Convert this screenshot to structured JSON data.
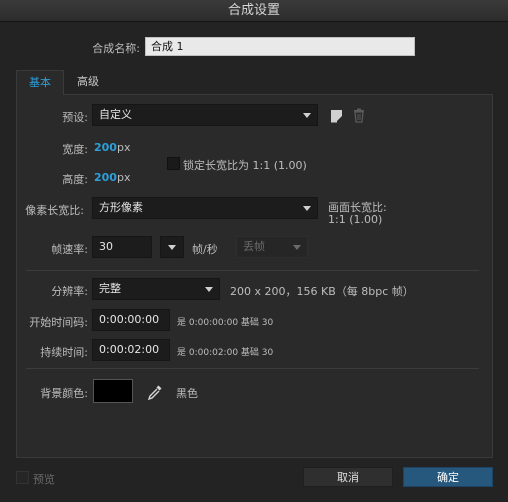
{
  "window": {
    "title": "合成设置"
  },
  "comp_name": {
    "label": "合成名称:",
    "value": "合成 1"
  },
  "tabs": [
    {
      "label": "基本"
    },
    {
      "label": "高级"
    }
  ],
  "preset": {
    "label": "预设:",
    "value": "自定义"
  },
  "width": {
    "label": "宽度:",
    "value": "200",
    "unit": "px"
  },
  "height": {
    "label": "高度:",
    "value": "200",
    "unit": "px"
  },
  "lock_aspect": {
    "label": "锁定长宽比为 1:1 (1.00)",
    "checked": false
  },
  "pixel_aspect": {
    "label": "像素长宽比:",
    "value": "方形像素"
  },
  "frame_aspect": {
    "label": "画面长宽比:",
    "value": "1:1 (1.00)"
  },
  "frame_rate": {
    "label": "帧速率:",
    "value": "30",
    "unit": "帧/秒",
    "drop_frame": "丢帧"
  },
  "resolution": {
    "label": "分辨率:",
    "value": "完整",
    "info": "200 x 200，156 KB（每 8bpc 帧）"
  },
  "start_timecode": {
    "label": "开始时间码:",
    "value": "0:00:00:00",
    "info": "是 0:00:00:00 基础 30"
  },
  "duration": {
    "label": "持续时间:",
    "value": "0:00:02:00",
    "info": "是 0:00:02:00 基础 30"
  },
  "background": {
    "label": "背景颜色:",
    "color": "#000000",
    "name": "黑色"
  },
  "footer": {
    "preview_label": "预览",
    "cancel_label": "取消",
    "ok_label": "确定"
  },
  "colors": {
    "accent": "#2d9fd9",
    "ok_button": "#26587d"
  }
}
